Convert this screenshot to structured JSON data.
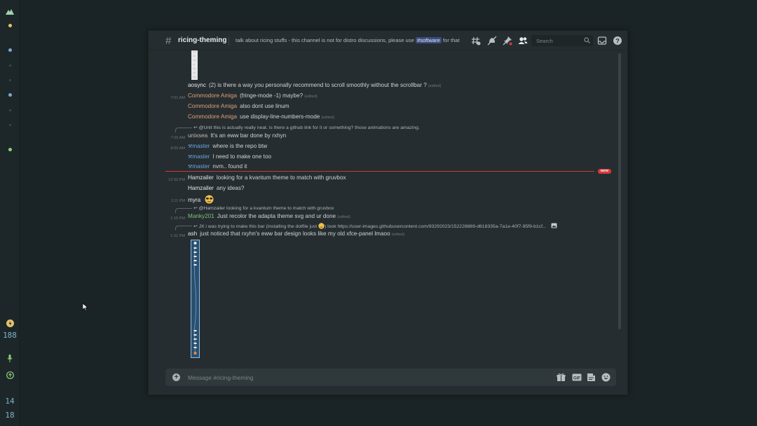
{
  "sysbar": {
    "battery_value": "188",
    "clock_hour": "14",
    "clock_minute": "18"
  },
  "header": {
    "channel_name": "ricing-theming",
    "topic_before": "talk about ricing stuffs - this channel is not for distro discussions, please use",
    "topic_chip": "#software",
    "topic_after": "for that",
    "search_placeholder": "Search"
  },
  "messages": [
    {
      "ts": "",
      "author": "aosync",
      "text": "(2) is there a way you personally recommend to scroll smoothly without the scrollbar ?",
      "edited": "(edited)"
    },
    {
      "ts": "7:01 AM",
      "author": "Commodore Amiga",
      "text": "(fringe-mode -1) maybe?",
      "edited": "(edited)"
    },
    {
      "ts": "",
      "author": "Commodore Amiga",
      "text": "also dont use linum",
      "edited": ""
    },
    {
      "ts": "",
      "author": "Commodore Amiga",
      "text": "use display-line-numbers-mode",
      "edited": "(edited)"
    },
    {
      "ts": "7:25 AM",
      "author": "unixsea",
      "text": "It's an eww bar done by rxhyn",
      "edited": "",
      "reply_to": "@Unit",
      "reply_text": "this is actually really neat. is there a github link for it or something? those animations are amazing."
    },
    {
      "ts": "8:00 AM",
      "author": "master",
      "text": "where is the repo btw",
      "edited": ""
    },
    {
      "ts": "",
      "author": "master",
      "text": "I need to make one too",
      "edited": ""
    },
    {
      "ts": "",
      "author": "master",
      "text": "nvm.. found it",
      "edited": ""
    },
    {
      "ts": "12:33 PM",
      "author": "Hamzailer",
      "text": "looking for a kvantum theme to match with gruvbox",
      "edited": ""
    },
    {
      "ts": "",
      "author": "Hamzailer",
      "text": "any ideas?",
      "edited": ""
    },
    {
      "ts": "1:11 PM",
      "author": "myra",
      "text": "",
      "edited": ""
    },
    {
      "ts": "1:15 PM",
      "author": "Manky201",
      "text": "Just recolor the adapta theme svg and ur done",
      "edited": "(edited)",
      "reply_to": "@Hamzailer",
      "reply_text": "looking for a kvantum theme to match with gruvbox"
    },
    {
      "ts": "1:31 PM",
      "author": "ash",
      "text": "just noticed that rxyhn's eww bar design looks like my old xfce-panel lmaoo",
      "edited": "(edited)",
      "reply_to": "JX",
      "reply_text": "i was trying to make this bar (installing the dotfile just",
      "reply_text2": ") look https://user-images.githubusercontent.com/93292023/152228869-d618335a-7a1e-40f7-95f9-b1cf..."
    }
  ],
  "new_label": "NEW",
  "composer": {
    "placeholder": "Message #ricing-theming"
  },
  "colors": {
    "background": "#1a2426",
    "window": "#252d30",
    "new_divider": "#c93a3a",
    "amiga": "#e09f75",
    "master": "#6aa5e0",
    "manky": "#7ec27a"
  }
}
